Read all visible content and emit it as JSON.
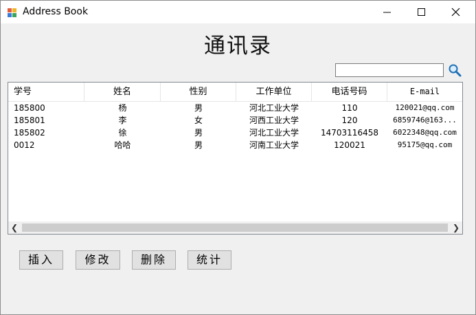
{
  "window": {
    "title": "Address Book"
  },
  "page": {
    "heading": "通讯录"
  },
  "search": {
    "value": "",
    "placeholder": ""
  },
  "table": {
    "columns": [
      "学号",
      "姓名",
      "性别",
      "工作单位",
      "电话号码",
      "E-mail"
    ],
    "rows": [
      [
        "185800",
        "杨",
        "男",
        "河北工业大学",
        "110",
        "120021@qq.com"
      ],
      [
        "185801",
        "李",
        "女",
        "河西工业大学",
        "120",
        "6859746@163..."
      ],
      [
        "185802",
        "徐",
        "男",
        "河北工业大学",
        "14703116458",
        "6022348@qq.com"
      ],
      [
        "0012",
        "哈哈",
        "男",
        "河南工业大学",
        "120021",
        "95175@qq.com"
      ]
    ]
  },
  "buttons": {
    "insert": "插入",
    "modify": "修改",
    "delete": "删除",
    "stats": "统计"
  },
  "icons": {
    "search": "magnifier-icon",
    "app": "address-book-icon"
  }
}
